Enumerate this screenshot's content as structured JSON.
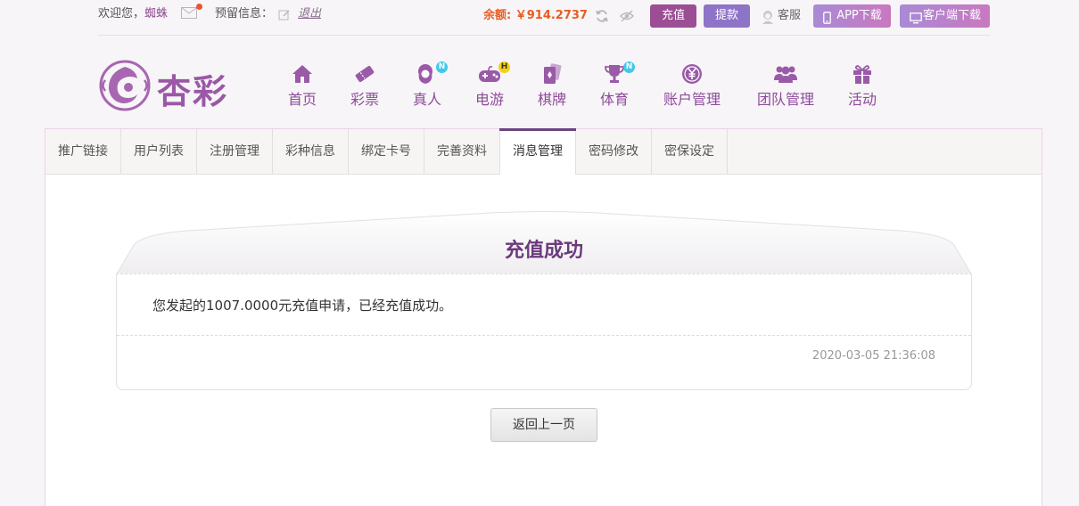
{
  "topbar": {
    "welcome": "欢迎您，",
    "username": "蜘蛛",
    "reserved_label": "预留信息：",
    "logout": "退出",
    "balance": "余额: ￥914.2737",
    "recharge": "充值",
    "withdraw": "提款",
    "service": "客服",
    "app_download": "APP下载",
    "client_download": "客户端下载"
  },
  "logo": {
    "text": "杏彩"
  },
  "nav": [
    {
      "label": "首页",
      "icon": "home-icon"
    },
    {
      "label": "彩票",
      "icon": "ticket-icon"
    },
    {
      "label": "真人",
      "icon": "live-dealer-icon",
      "badge": "N"
    },
    {
      "label": "电游",
      "icon": "gamepad-icon",
      "badge": "H"
    },
    {
      "label": "棋牌",
      "icon": "cards-icon"
    },
    {
      "label": "体育",
      "icon": "trophy-icon",
      "badge": "N"
    },
    {
      "label": "账户管理",
      "icon": "yen-coin-icon"
    },
    {
      "label": "团队管理",
      "icon": "team-icon"
    },
    {
      "label": "活动",
      "icon": "gift-icon"
    }
  ],
  "tabs": [
    {
      "label": "推广链接"
    },
    {
      "label": "用户列表"
    },
    {
      "label": "注册管理"
    },
    {
      "label": "彩种信息"
    },
    {
      "label": "绑定卡号"
    },
    {
      "label": "完善资料"
    },
    {
      "label": "消息管理",
      "active": true
    },
    {
      "label": "密码修改"
    },
    {
      "label": "密保设定"
    }
  ],
  "message": {
    "title": "充值成功",
    "body": "您发起的1007.0000元充值申请，已经充值成功。",
    "time": "2020-03-05 21:36:08"
  },
  "back_button": "返回上一页",
  "colors": {
    "brand_purple": "#8e4a9b",
    "balance_orange": "#e65d22",
    "recharge_bg": "#9b4e94",
    "withdraw_bg": "#8e74c7"
  }
}
